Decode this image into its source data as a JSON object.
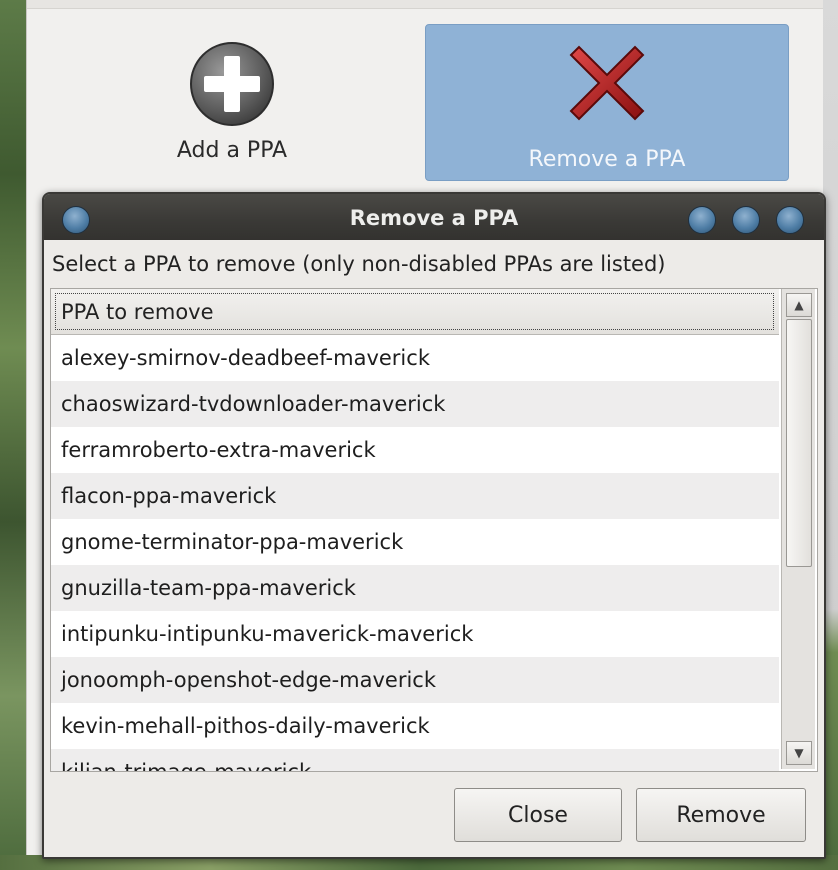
{
  "app": {
    "add_button_label": "Add a PPA",
    "remove_button_label": "Remove a PPA",
    "remove_button_color": "#8fb2d6"
  },
  "dialog": {
    "title": "Remove a PPA",
    "prompt": "Select a PPA to remove (only non-disabled PPAs are listed)",
    "column_header": "PPA to remove",
    "items": [
      "alexey-smirnov-deadbeef-maverick",
      "chaoswizard-tvdownloader-maverick",
      "ferramroberto-extra-maverick",
      "flacon-ppa-maverick",
      "gnome-terminator-ppa-maverick",
      "gnuzilla-team-ppa-maverick",
      "intipunku-intipunku-maverick-maverick",
      "jonoomph-openshot-edge-maverick",
      "kevin-mehall-pithos-daily-maverick",
      "kilian-trimage-maverick"
    ],
    "close_label": "Close",
    "remove_label": "Remove"
  },
  "icons": {
    "add": "plus-circle-icon",
    "remove": "red-x-icon",
    "scroll_up": "arrow-up-icon",
    "scroll_down": "arrow-down-icon"
  }
}
